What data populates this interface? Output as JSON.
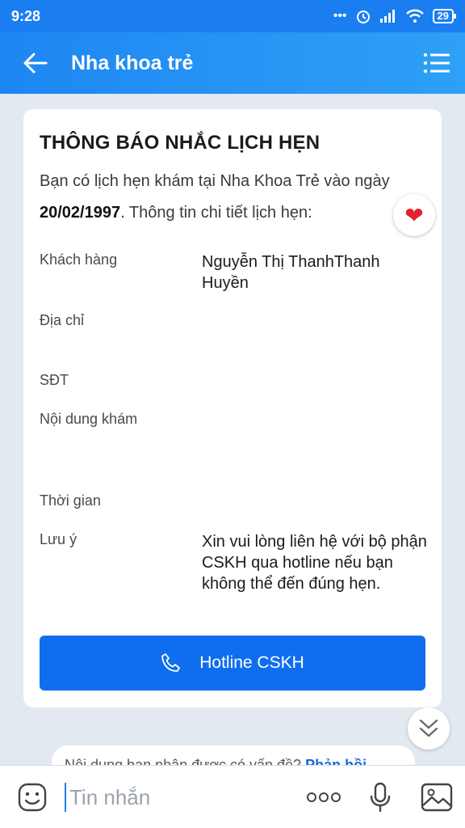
{
  "status_bar": {
    "time": "9:28",
    "battery": "29"
  },
  "app_bar": {
    "title": "Nha khoa trẻ"
  },
  "card": {
    "heading": "THÔNG BÁO NHẮC LỊCH HẸN",
    "intro_text": "Bạn có lịch hẹn khám tại Nha Khoa Trẻ vào ngày ",
    "intro_date": "20/02/1997",
    "intro_tail": ". Thông tin chi tiết lịch hẹn:",
    "fields": [
      {
        "label": "Khách hàng",
        "value": "Nguyễn Thị ThanhThanh Huyền"
      },
      {
        "label": "Địa chỉ",
        "value": ""
      },
      {
        "label": "SĐT",
        "value": ""
      },
      {
        "label": "Nội dung khám",
        "value": ""
      },
      {
        "label": "Thời gian",
        "value": ""
      },
      {
        "label": "Lưu ý",
        "value": "Xin vui lòng liên hệ với bộ phận CSKH qua hotline nếu bạn không thể đến đúng hẹn."
      }
    ],
    "hotline_label": "Hotline CSKH"
  },
  "feedback": {
    "text": "Nội dung bạn nhận được có vấn đề? ",
    "link": "Phản hồi"
  },
  "input": {
    "placeholder": "Tin nhắn"
  },
  "icons": {
    "back": "back-arrow-icon",
    "menu": "menu-list-icon",
    "heart": "heart-icon",
    "phone": "phone-icon",
    "scroll": "double-chevron-down-icon",
    "emoji": "emoji-icon",
    "more": "more-dots-icon",
    "mic": "microphone-icon",
    "image": "image-icon"
  },
  "colors": {
    "accent": "#1a7ef0",
    "hotline": "#0f6ef0",
    "heart": "#e0242e"
  }
}
